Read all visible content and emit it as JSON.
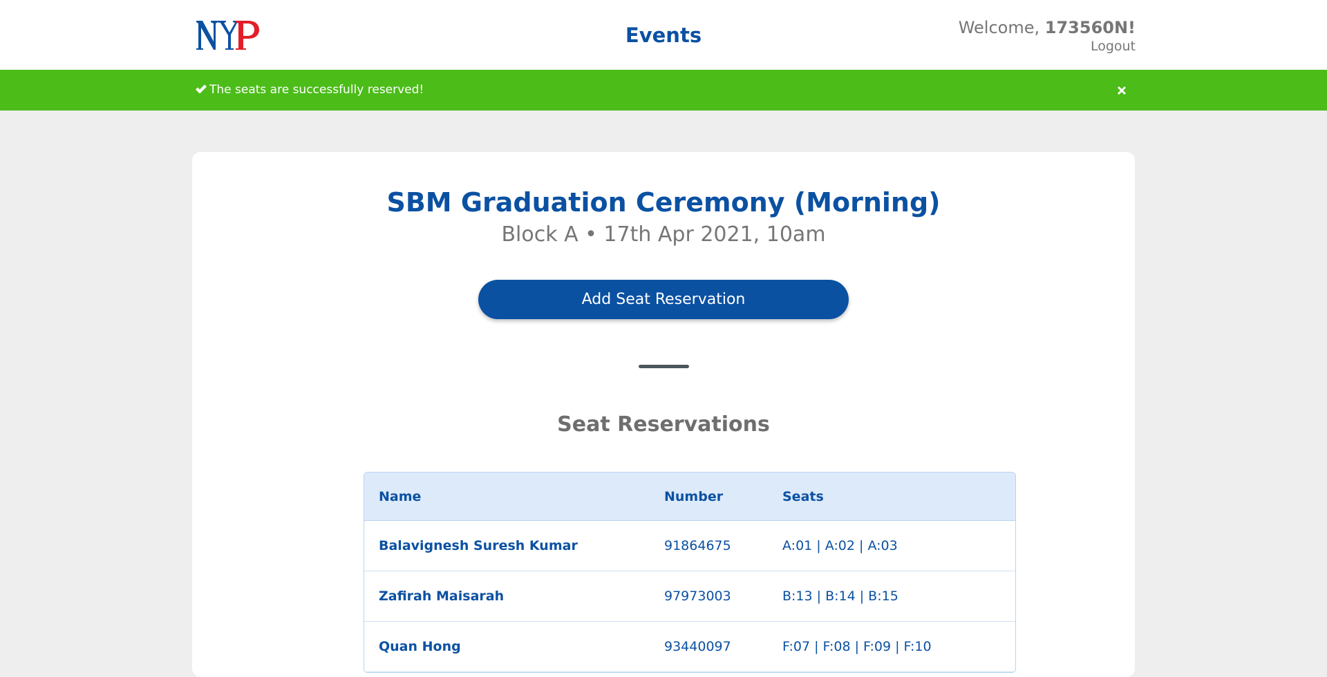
{
  "header": {
    "logo_text": "NYP",
    "title": "Events",
    "welcome_prefix": "Welcome, ",
    "username": "173560N!",
    "logout_label": "Logout"
  },
  "alert": {
    "message": "The seats are successfully reserved!",
    "color": "#4cbc19"
  },
  "event": {
    "title": "SBM Graduation Ceremony  (Morning)",
    "subtitle": "Block A • 17th Apr 2021, 10am",
    "add_button_label": "Add Seat Reservation"
  },
  "reservations": {
    "section_title": "Seat Reservations",
    "columns": [
      "Name",
      "Number",
      "Seats"
    ],
    "rows": [
      {
        "name": "Balavignesh Suresh Kumar",
        "number": "91864675",
        "seats": "A:01 | A:02 | A:03"
      },
      {
        "name": "Zafirah Maisarah",
        "number": "97973003",
        "seats": "B:13 | B:14 | B:15"
      },
      {
        "name": "Quan Hong",
        "number": "93440097",
        "seats": "F:07 | F:08 | F:09 | F:10"
      }
    ]
  },
  "colors": {
    "brand_blue": "#0b51a2",
    "logo_red": "#e31e26",
    "background": "#eeeeee"
  }
}
